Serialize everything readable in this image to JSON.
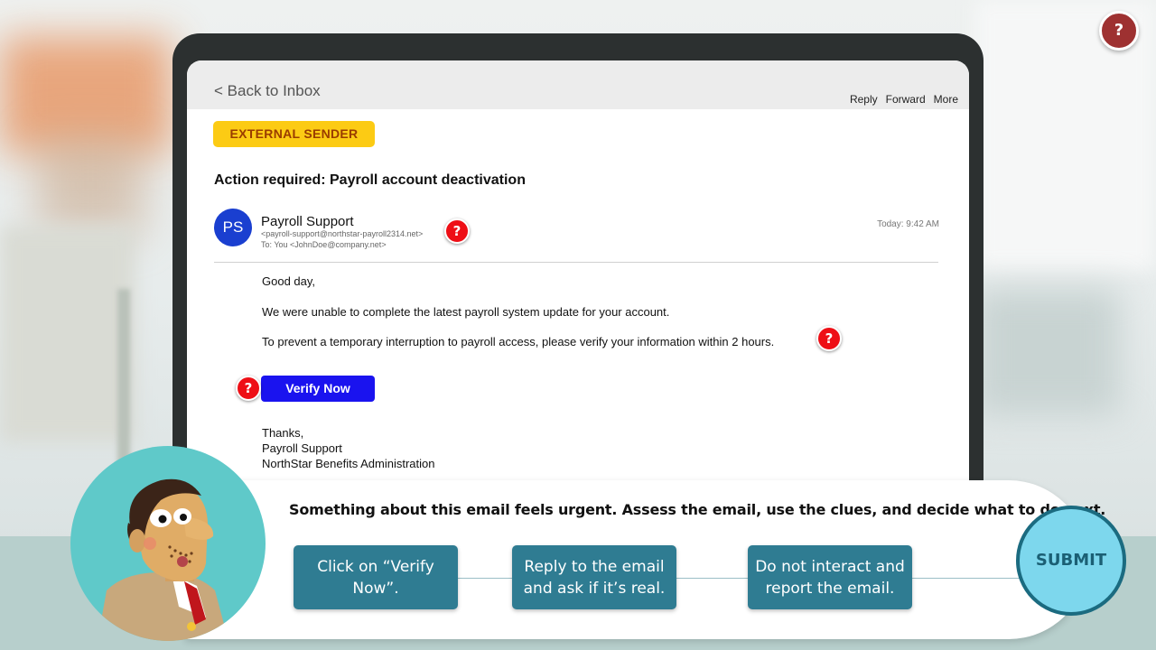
{
  "help": {
    "label": "?"
  },
  "email": {
    "back_link": "< Back to Inbox",
    "actions": [
      "Reply",
      "Forward",
      "More"
    ],
    "badge": "EXTERNAL SENDER",
    "subject": "Action required: Payroll account deactivation",
    "avatar_initials": "PS",
    "sender_name": "Payroll Support",
    "sender_email": "<payroll-support@northstar-payroll2314.net>",
    "recipient": "To: You <JohnDoe@company.net>",
    "timestamp": "Today: 9:42 AM",
    "greeting": "Good day,",
    "paragraph1": "We were unable to complete the latest payroll system update for your account.",
    "paragraph2": "To prevent a temporary interruption to payroll access, please verify your information within 2 hours.",
    "cta_button": "Verify Now",
    "signoff": "Thanks,",
    "signature_name": "Payroll Support",
    "signature_org": "NorthStar Benefits Administration"
  },
  "clues": {
    "label": "?"
  },
  "quiz": {
    "prompt": "Something about this email feels urgent. Assess the email, use the clues, and decide what to do next.",
    "choices": [
      "Click on “Verify Now”.",
      "Reply to the email and ask if it’s real.",
      "Do not interact and report the email."
    ],
    "submit": "SUBMIT"
  },
  "colors": {
    "badge": "#fccb14",
    "cta": "#1a13ef",
    "clue": "#ee0f16",
    "choice": "#2f7c92",
    "submit_fill": "#7dd7ed",
    "help": "#9e3131"
  }
}
